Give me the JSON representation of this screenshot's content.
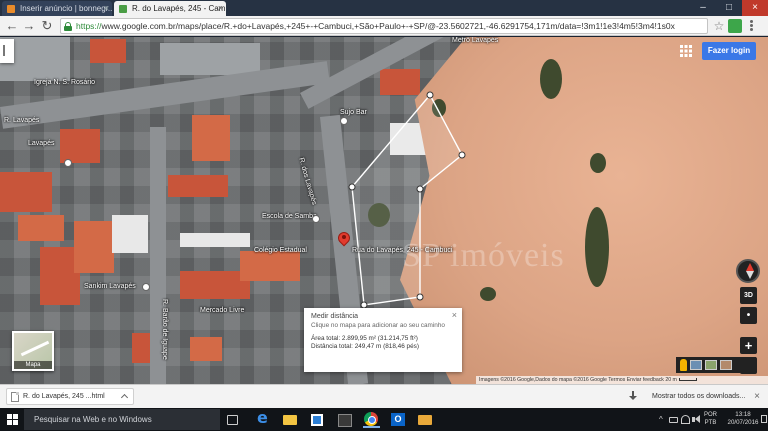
{
  "browser": {
    "tabs": [
      {
        "label": "Inserir anúncio | bonnegr..."
      },
      {
        "label": "R. do Lavapés, 245 - Cam..."
      }
    ],
    "url_https": "https://",
    "url_rest": "www.google.com.br/maps/place/R.+do+Lavapés,+245+-+Cambuci,+São+Paulo+-+SP/@-23.5602721,-46.6291754,171m/data=!3m1!1e3!4m5!3m4!1s0x"
  },
  "map": {
    "login_label": "Fazer login",
    "labels": {
      "street_a": "Metrô Lavapés",
      "church": "Igreja N. S. Rosário",
      "street_b": "R. Lavapés",
      "poi_a": "Lavapés",
      "poi_b": "Sujo Bar",
      "poi_c": "Escola de Samba",
      "poi_d": "Rua do Lavapés, 245 - Cambuci",
      "poi_e": "Sankim Lavapés",
      "street_c": "R. dos Lavapés",
      "poi_f": "Mercado Livre",
      "poi_g": "Colégio Estadual",
      "street_d": "R. Barão de Iguape"
    },
    "watermark": "SP imóveis",
    "thumbnail_label": "Mapa",
    "controls": {
      "three_d": "3D",
      "zoom_in": "+",
      "zoom_out": "−"
    },
    "attribution": "Imagens ©2016 Google,Dados do mapa ©2016 Google   Termos   Enviar feedback   20 m"
  },
  "measure": {
    "title": "Medir distância",
    "hint": "Clique no mapa para adicionar ao seu caminho",
    "area": "Área total: 2.899,95 m² (31.214,75 ft²)",
    "distance": "Distância total: 249,47 m (818,46 pés)",
    "close": "×"
  },
  "download_shelf": {
    "file_name": "R. do Lavapés, 245 ...html",
    "show_all": "Mostrar todos os downloads...",
    "close": "×"
  },
  "taskbar": {
    "search_text": "Pesquisar na Web e no Windows",
    "lang_1": "POR",
    "lang_2": "PTB",
    "time": "13:18",
    "date": "20/07/2016"
  }
}
